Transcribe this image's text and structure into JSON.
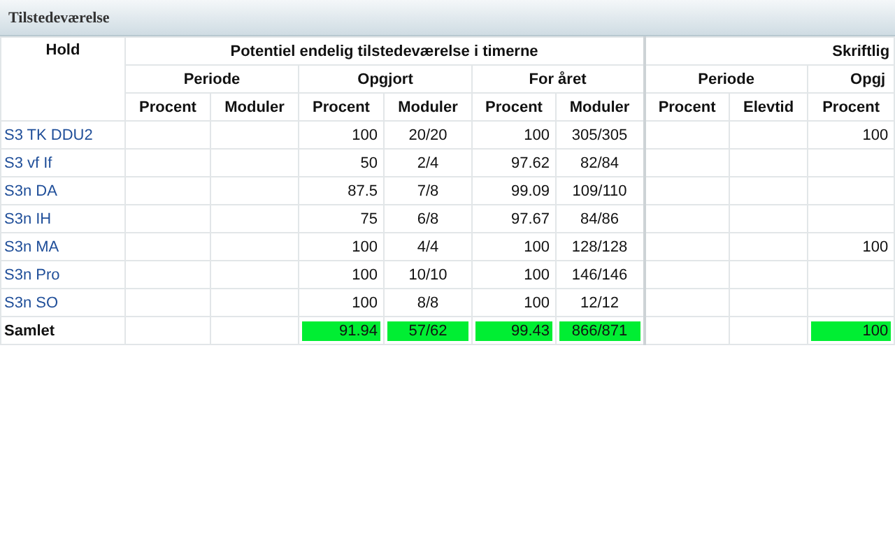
{
  "window": {
    "title": "Tilstedeværelse"
  },
  "table": {
    "header_rows": [
      {
        "hold": "Hold",
        "groups": [
          "Potentiel endelig tilstedeværelse i timerne",
          "Skriftlig"
        ]
      },
      {
        "groups": [
          "Periode",
          "Opgjort",
          "For året",
          "Periode",
          "Opgj"
        ]
      },
      {
        "columns": [
          "Procent",
          "Moduler",
          "Procent",
          "Moduler",
          "Procent",
          "Moduler",
          "Procent",
          "Elevtid",
          "Procent"
        ]
      }
    ],
    "rows": [
      {
        "kind": "course",
        "hold": "S3 TK DDU2",
        "highlighted": false,
        "cells": [
          null,
          null,
          "100",
          "20/20",
          "100",
          "305/305",
          null,
          null,
          "100"
        ]
      },
      {
        "kind": "course",
        "hold": "S3 vf If",
        "highlighted": false,
        "cells": [
          null,
          null,
          "50",
          "2/4",
          "97.62",
          "82/84",
          null,
          null,
          null
        ]
      },
      {
        "kind": "course",
        "hold": "S3n DA",
        "highlighted": false,
        "cells": [
          null,
          null,
          "87.5",
          "7/8",
          "99.09",
          "109/110",
          null,
          null,
          null
        ]
      },
      {
        "kind": "course",
        "hold": "S3n IH",
        "highlighted": false,
        "cells": [
          null,
          null,
          "75",
          "6/8",
          "97.67",
          "84/86",
          null,
          null,
          null
        ]
      },
      {
        "kind": "course",
        "hold": "S3n MA",
        "highlighted": false,
        "cells": [
          null,
          null,
          "100",
          "4/4",
          "100",
          "128/128",
          null,
          null,
          "100"
        ]
      },
      {
        "kind": "course",
        "hold": "S3n Pro",
        "highlighted": false,
        "cells": [
          null,
          null,
          "100",
          "10/10",
          "100",
          "146/146",
          null,
          null,
          null
        ]
      },
      {
        "kind": "course",
        "hold": "S3n SO",
        "highlighted": false,
        "cells": [
          null,
          null,
          "100",
          "8/8",
          "100",
          "12/12",
          null,
          null,
          null
        ]
      },
      {
        "kind": "total",
        "hold": "Samlet",
        "highlighted": true,
        "cells": [
          null,
          null,
          "91.94",
          "57/62",
          "99.43",
          "866/871",
          null,
          null,
          "100"
        ]
      }
    ]
  }
}
